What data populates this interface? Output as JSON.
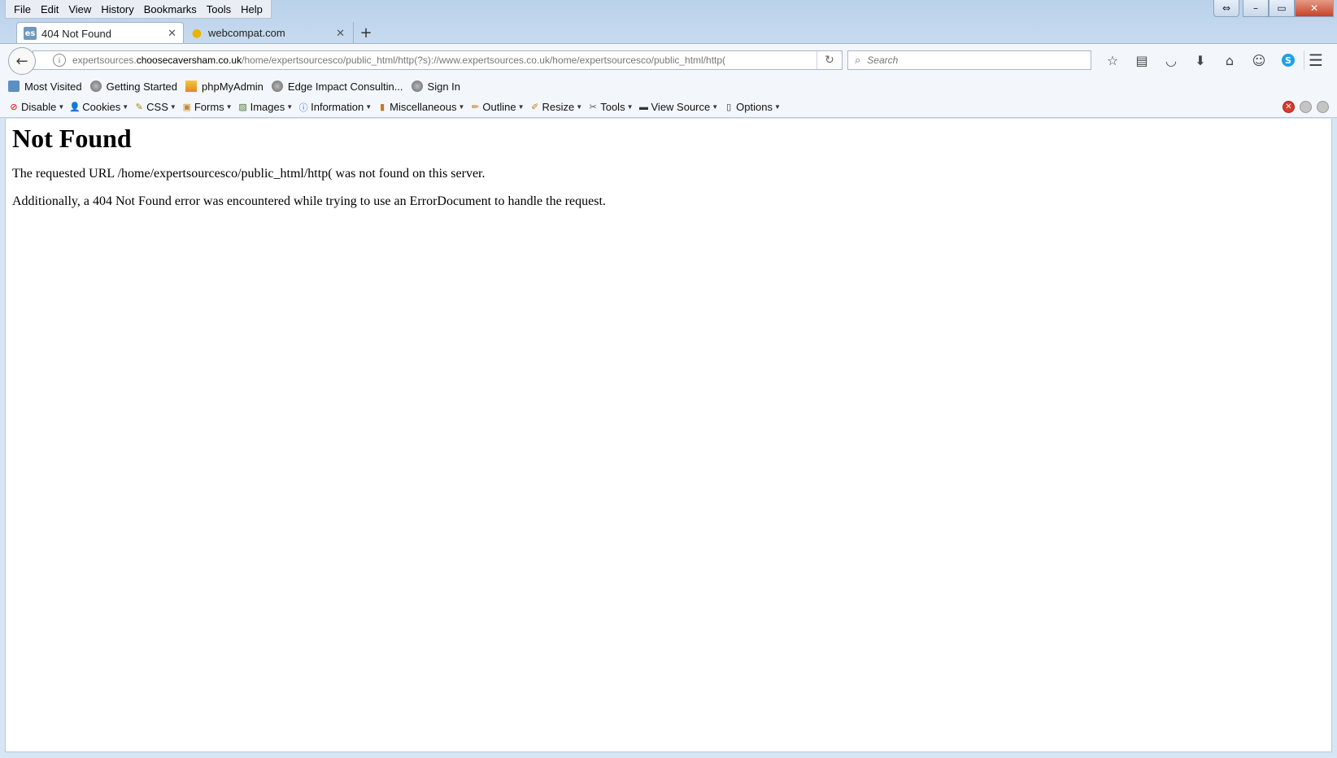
{
  "menubar": {
    "items": [
      "File",
      "Edit",
      "View",
      "History",
      "Bookmarks",
      "Tools",
      "Help"
    ]
  },
  "tabs": [
    {
      "title": "404 Not Found",
      "favicon": "es",
      "active": true
    },
    {
      "title": "webcompat.com",
      "favicon": "webcompat-icon",
      "active": false
    }
  ],
  "navbar": {
    "url_host_pre": "expertsources.",
    "url_host_domain": "choosecaversham.co.uk",
    "url_path": "/home/expertsourcesco/public_html/http(?s)://www.expertsources.co.uk/home/expertsourcesco/public_html/http(",
    "search_placeholder": "Search"
  },
  "bookmarks": [
    {
      "label": "Most Visited",
      "icon": "most-visited-icon"
    },
    {
      "label": "Getting Started",
      "icon": "globe-icon"
    },
    {
      "label": "phpMyAdmin",
      "icon": "pma-icon"
    },
    {
      "label": "Edge Impact Consultin...",
      "icon": "globe-icon"
    },
    {
      "label": "Sign In",
      "icon": "globe-icon"
    }
  ],
  "devbar": [
    {
      "label": "Disable",
      "icon": "disable-icon"
    },
    {
      "label": "Cookies",
      "icon": "cookies-icon"
    },
    {
      "label": "CSS",
      "icon": "css-icon"
    },
    {
      "label": "Forms",
      "icon": "forms-icon"
    },
    {
      "label": "Images",
      "icon": "images-icon"
    },
    {
      "label": "Information",
      "icon": "information-icon"
    },
    {
      "label": "Miscellaneous",
      "icon": "miscellaneous-icon"
    },
    {
      "label": "Outline",
      "icon": "outline-icon"
    },
    {
      "label": "Resize",
      "icon": "resize-icon"
    },
    {
      "label": "Tools",
      "icon": "tools-icon"
    },
    {
      "label": "View Source",
      "icon": "view-source-icon"
    },
    {
      "label": "Options",
      "icon": "options-icon"
    }
  ],
  "page": {
    "heading": "Not Found",
    "line1": "The requested URL /home/expertsourcesco/public_html/http( was not found on this server.",
    "line2": "Additionally, a 404 Not Found error was encountered while trying to use an ErrorDocument to handle the request."
  },
  "colors": {
    "chrome_bg": "#b9d1ea",
    "toolbar_bg": "#f3f7fc",
    "close_red": "#d83a2c"
  }
}
